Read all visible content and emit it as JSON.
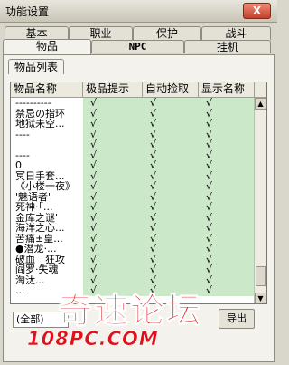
{
  "window": {
    "title": "功能设置",
    "close_label": "X"
  },
  "tabs_row1": [
    {
      "label": "基本"
    },
    {
      "label": "职业"
    },
    {
      "label": "保护"
    },
    {
      "label": "战斗"
    }
  ],
  "tabs_row2": [
    {
      "label": "物品",
      "active": true
    },
    {
      "label": "NPC"
    },
    {
      "label": "挂机"
    }
  ],
  "subtab": {
    "label": "物品列表"
  },
  "table": {
    "columns": [
      "物品名称",
      "极品提示",
      "自动捡取",
      "显示名称"
    ],
    "check_mark": "√",
    "rows": [
      {
        "name": "----------"
      },
      {
        "name": "禁忌の指环"
      },
      {
        "name": "地狱未空..."
      },
      {
        "name": "----"
      },
      {
        "name": ""
      },
      {
        "name": "----"
      },
      {
        "name": "0"
      },
      {
        "name": "冥日手套..."
      },
      {
        "name": "《小楼一夜》"
      },
      {
        "name": "'魅语者'"
      },
      {
        "name": "死神·「..."
      },
      {
        "name": "金库之谜'"
      },
      {
        "name": "海洋之心..."
      },
      {
        "name": "苦痛±皇..."
      },
      {
        "name": "●潜龙·..."
      },
      {
        "name": "破血「狂攻"
      },
      {
        "name": "阎罗·失魂"
      },
      {
        "name": "淘汰..."
      },
      {
        "name": "..."
      }
    ]
  },
  "filter": {
    "value": "(全部)"
  },
  "action_button": {
    "label": "导出"
  },
  "watermark": {
    "title": "奇速论坛",
    "url": "108PC.COM",
    "color": "#e0111b"
  }
}
